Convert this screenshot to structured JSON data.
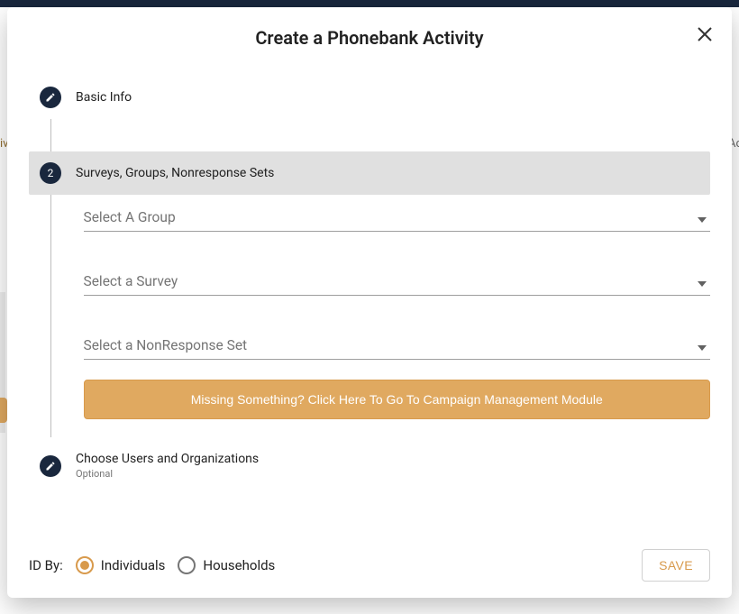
{
  "modal": {
    "title": "Create a Phonebank Activity"
  },
  "steps": {
    "step1": {
      "label": "Basic Info"
    },
    "step2": {
      "num": "2",
      "label": "Surveys, Groups, Nonresponse Sets"
    },
    "step3": {
      "label": "Choose Users and Organizations",
      "sub": "Optional"
    }
  },
  "fields": {
    "group": {
      "placeholder": "Select A Group"
    },
    "survey": {
      "placeholder": "Select a Survey"
    },
    "nonresponse": {
      "placeholder": "Select a NonResponse Set"
    }
  },
  "cta": {
    "missing": "Missing Something? Click Here To Go To Campaign Management Module"
  },
  "footer": {
    "idby_label": "ID By:",
    "individuals": "Individuals",
    "households": "Households",
    "save": "SAVE"
  },
  "bg": {
    "left_tab": "iv",
    "right_tab": "Ac"
  }
}
